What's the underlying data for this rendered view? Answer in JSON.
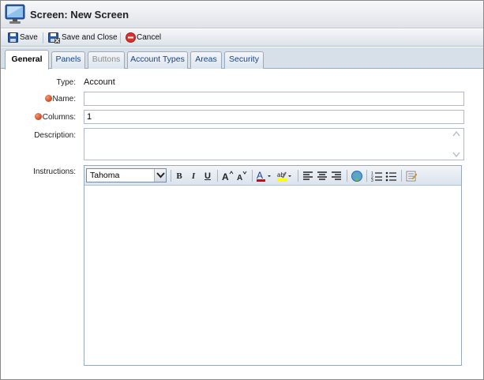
{
  "window": {
    "title": "Screen: New Screen",
    "icon": "monitor-icon"
  },
  "toolbar": {
    "save_label": "Save",
    "save_close_label": "Save and Close",
    "cancel_label": "Cancel"
  },
  "tabs": [
    {
      "label": "General",
      "state": "active"
    },
    {
      "label": "Panels",
      "state": "normal"
    },
    {
      "label": "Buttons",
      "state": "disabled"
    },
    {
      "label": "Account Types",
      "state": "normal"
    },
    {
      "label": "Areas",
      "state": "normal"
    },
    {
      "label": "Security",
      "state": "normal"
    }
  ],
  "form": {
    "type_label": "Type:",
    "type_value": "Account",
    "name_label": "Name:",
    "name_value": "",
    "columns_label": "Columns:",
    "columns_value": "1",
    "description_label": "Description:",
    "description_value": "",
    "instructions_label": "Instructions:"
  },
  "editor": {
    "font_value": "Tahoma",
    "buttons": [
      "bold",
      "italic",
      "underline",
      "grow-font",
      "shrink-font",
      "font-color",
      "highlight-color",
      "align-left",
      "align-center",
      "align-right",
      "insert-link",
      "ordered-list",
      "unordered-list",
      "source-edit"
    ],
    "colors": {
      "font_color": "#e00000",
      "highlight_color": "#ffff00"
    }
  },
  "colors": {
    "accent": "#15428b",
    "required": "#d2441b",
    "cancel": "#d9312b"
  }
}
